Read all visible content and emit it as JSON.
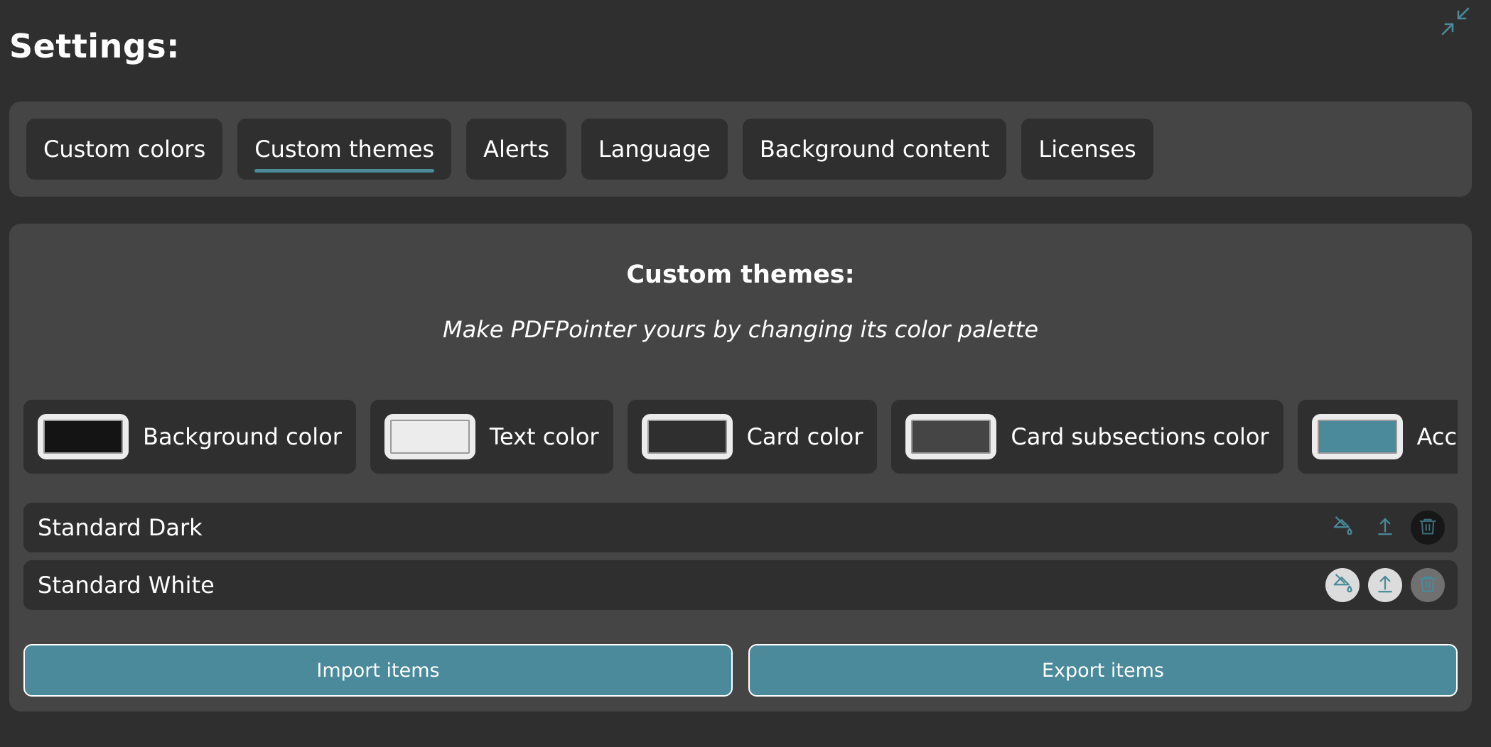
{
  "page": {
    "title": "Settings:"
  },
  "tabs": [
    {
      "label": "Custom colors",
      "active": false
    },
    {
      "label": "Custom themes",
      "active": true
    },
    {
      "label": "Alerts",
      "active": false
    },
    {
      "label": "Language",
      "active": false
    },
    {
      "label": "Background content",
      "active": false
    },
    {
      "label": "Licenses",
      "active": false
    }
  ],
  "custom_themes": {
    "title": "Custom themes:",
    "subtitle": "Make PDFPointer yours by changing its color palette",
    "colors": [
      {
        "label": "Background color",
        "value": "#141414"
      },
      {
        "label": "Text color",
        "value": "#ececec"
      },
      {
        "label": "Card color",
        "value": "#2f2f2f"
      },
      {
        "label": "Card subsections color",
        "value": "#454545"
      },
      {
        "label": "Accent color",
        "value": "#4a8a9a"
      }
    ],
    "themes": [
      {
        "name": "Standard Dark",
        "icons": [
          "paint-bucket-icon",
          "upload-icon",
          "trash-icon"
        ]
      },
      {
        "name": "Standard White",
        "icons": [
          "paint-bucket-icon",
          "upload-icon",
          "trash-icon"
        ]
      }
    ],
    "import_label": "Import items",
    "export_label": "Export items"
  },
  "colors": {
    "page_bg": "#2f2f2f",
    "card_bg": "#454545",
    "accent": "#4a8a9a"
  }
}
